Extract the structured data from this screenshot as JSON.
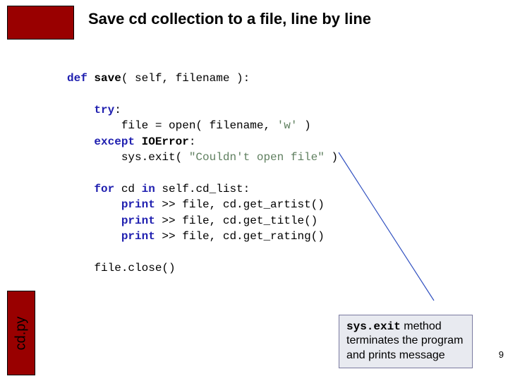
{
  "title": "Save cd collection to a file, line by line",
  "filename_label": "cd.py",
  "page_number": "9",
  "code": {
    "def_kw": "def",
    "fn_name": "save",
    "sig_rest": "( self, filename ):",
    "try_kw": "try",
    "open_line": "file = open( filename, ",
    "open_str": "'w'",
    "open_after": " )",
    "except_kw": "except",
    "io_error": "IOError",
    "sysexit": "sys.exit( ",
    "sysexit_str": "\"Couldn't open file\"",
    "sysexit_after": " )",
    "for_kw": "for",
    "for_mid": " cd ",
    "in_kw": "in",
    "for_rest": " self.cd_list:",
    "print_kw": "print",
    "p_artist": " >> file, cd.get_artist()",
    "p_title": " >> file, cd.get_title()",
    "p_rating": " >> file, cd.get_rating()",
    "close_line": "file.close()"
  },
  "callout": {
    "mono": "sys.exit",
    "rest": " method terminates the program and prints message"
  }
}
